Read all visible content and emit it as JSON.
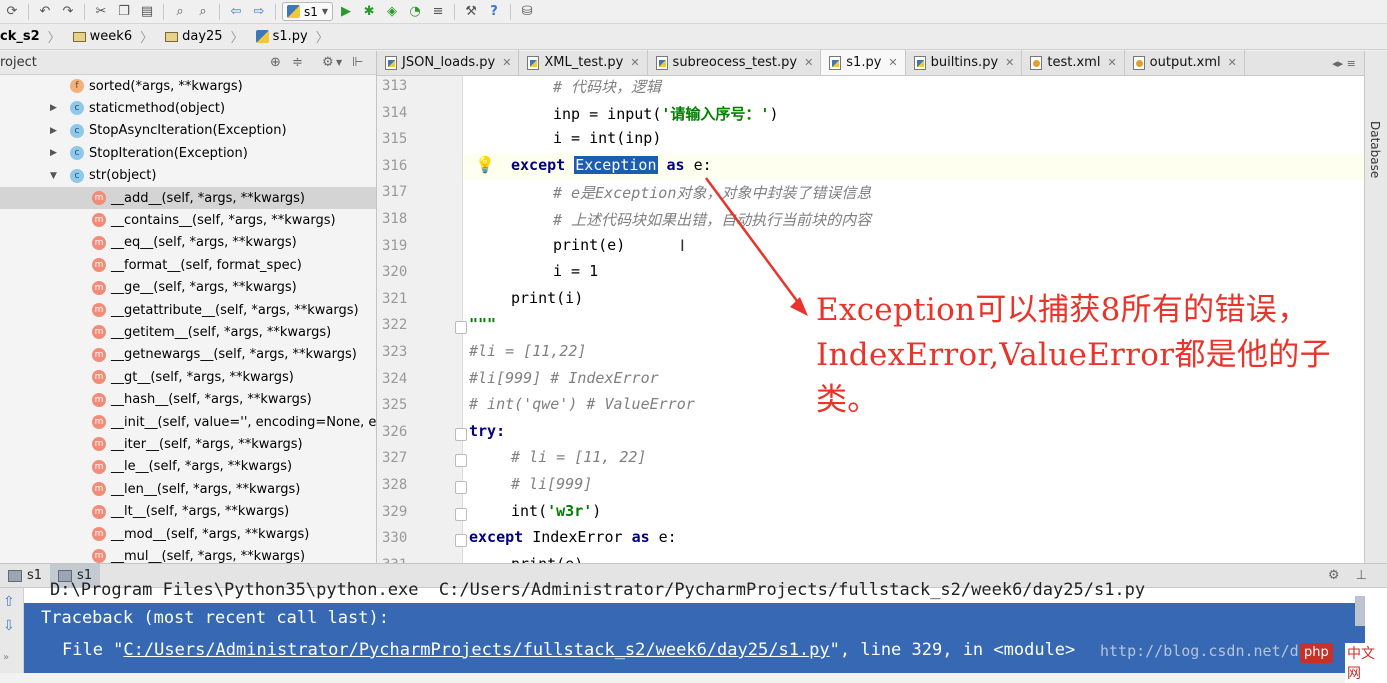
{
  "toolbar": {
    "run_config": "s1",
    "icons": [
      "sync-icon",
      "undo-icon",
      "redo-icon",
      "cut-icon",
      "copy-icon",
      "paste-icon",
      "find-icon",
      "replace-icon",
      "back-icon",
      "forward-icon",
      "run-config-icon",
      "run-icon",
      "debug-icon",
      "coverage-icon",
      "profile-icon",
      "concurrency-icon",
      "settings-icon",
      "help-icon",
      "vcs-icon"
    ]
  },
  "breadcrumb": {
    "items": [
      "ck_s2",
      "week6",
      "day25",
      "s1.py"
    ]
  },
  "project_panel": {
    "title": "roject",
    "tree": [
      {
        "badge": "f",
        "label": "sorted(*args, **kwargs)",
        "arrow": ""
      },
      {
        "badge": "c",
        "label": "staticmethod(object)",
        "arrow": "▶"
      },
      {
        "badge": "c",
        "label": "StopAsyncIteration(Exception)",
        "arrow": "▶"
      },
      {
        "badge": "c",
        "label": "StopIteration(Exception)",
        "arrow": "▶"
      },
      {
        "badge": "c",
        "label": "str(object)",
        "arrow": "▼"
      },
      {
        "badge": "m",
        "label": "__add__(self, *args, **kwargs)",
        "arrow": ""
      },
      {
        "badge": "m",
        "label": "__contains__(self, *args, **kwargs)",
        "arrow": ""
      },
      {
        "badge": "m",
        "label": "__eq__(self, *args, **kwargs)",
        "arrow": ""
      },
      {
        "badge": "m",
        "label": "__format__(self, format_spec)",
        "arrow": ""
      },
      {
        "badge": "m",
        "label": "__ge__(self, *args, **kwargs)",
        "arrow": ""
      },
      {
        "badge": "m",
        "label": "__getattribute__(self, *args, **kwargs)",
        "arrow": ""
      },
      {
        "badge": "m",
        "label": "__getitem__(self, *args, **kwargs)",
        "arrow": ""
      },
      {
        "badge": "m",
        "label": "__getnewargs__(self, *args, **kwargs)",
        "arrow": ""
      },
      {
        "badge": "m",
        "label": "__gt__(self, *args, **kwargs)",
        "arrow": ""
      },
      {
        "badge": "m",
        "label": "__hash__(self, *args, **kwargs)",
        "arrow": ""
      },
      {
        "badge": "m",
        "label": "__init__(self, value='', encoding=None, erro",
        "arrow": ""
      },
      {
        "badge": "m",
        "label": "__iter__(self, *args, **kwargs)",
        "arrow": ""
      },
      {
        "badge": "m",
        "label": "__le__(self, *args, **kwargs)",
        "arrow": ""
      },
      {
        "badge": "m",
        "label": "__len__(self, *args, **kwargs)",
        "arrow": ""
      },
      {
        "badge": "m",
        "label": "__lt__(self, *args, **kwargs)",
        "arrow": ""
      },
      {
        "badge": "m",
        "label": "__mod__(self, *args, **kwargs)",
        "arrow": ""
      },
      {
        "badge": "m",
        "label": "__mul__(self, *args, **kwargs)",
        "arrow": ""
      }
    ]
  },
  "tabs": [
    {
      "label": "JSON_loads.py",
      "icon": "py",
      "active": false
    },
    {
      "label": "XML_test.py",
      "icon": "py",
      "active": false
    },
    {
      "label": "subreocess_test.py",
      "icon": "py",
      "active": false
    },
    {
      "label": "s1.py",
      "icon": "py",
      "active": true
    },
    {
      "label": "builtins.py",
      "icon": "py",
      "active": false
    },
    {
      "label": "test.xml",
      "icon": "xml",
      "active": false
    },
    {
      "label": "output.xml",
      "icon": "xml",
      "active": false
    }
  ],
  "editor": {
    "lines": [
      {
        "n": "313",
        "indent": 2,
        "parts": [
          [
            "cm",
            "# 代码块，逻辑"
          ]
        ]
      },
      {
        "n": "314",
        "indent": 2,
        "parts": [
          [
            "",
            "inp = input("
          ],
          [
            "str",
            "'请输入序号：'"
          ],
          [
            "",
            ")"
          ]
        ]
      },
      {
        "n": "315",
        "indent": 2,
        "parts": [
          [
            "",
            "i = int(inp)"
          ]
        ]
      },
      {
        "n": "316",
        "indent": 1,
        "parts": [
          [
            "kw",
            "except "
          ],
          [
            "hl",
            "Exception"
          ],
          [
            "kw",
            " as "
          ],
          [
            "",
            "e:"
          ]
        ]
      },
      {
        "n": "317",
        "indent": 2,
        "parts": [
          [
            "cm",
            "# e是Exception对象，对象中封装了错误信息"
          ]
        ]
      },
      {
        "n": "318",
        "indent": 2,
        "parts": [
          [
            "cm",
            "# 上述代码块如果出错，自动执行当前块的内容"
          ]
        ]
      },
      {
        "n": "319",
        "indent": 2,
        "parts": [
          [
            "",
            "print(e)"
          ]
        ]
      },
      {
        "n": "320",
        "indent": 2,
        "parts": [
          [
            "",
            "i = 1"
          ]
        ]
      },
      {
        "n": "321",
        "indent": 1,
        "parts": [
          [
            "",
            "print(i)"
          ]
        ]
      },
      {
        "n": "322",
        "indent": 0,
        "parts": [
          [
            "str",
            "\"\"\""
          ]
        ]
      },
      {
        "n": "323",
        "indent": 0,
        "parts": [
          [
            "cn",
            "#li = [11,22]"
          ]
        ]
      },
      {
        "n": "324",
        "indent": 0,
        "parts": [
          [
            "cn",
            "#li[999] # IndexError"
          ]
        ]
      },
      {
        "n": "325",
        "indent": 0,
        "parts": [
          [
            "cn",
            "# int('qwe') # ValueError"
          ]
        ]
      },
      {
        "n": "326",
        "indent": 0,
        "parts": [
          [
            "kw",
            "try:"
          ]
        ]
      },
      {
        "n": "327",
        "indent": 1,
        "parts": [
          [
            "cn",
            "# li = [11, 22]"
          ]
        ]
      },
      {
        "n": "328",
        "indent": 1,
        "parts": [
          [
            "cn",
            "# li[999]"
          ]
        ]
      },
      {
        "n": "329",
        "indent": 1,
        "parts": [
          [
            "",
            "int("
          ],
          [
            "str",
            "'w3r'"
          ],
          [
            "",
            ")"
          ]
        ]
      },
      {
        "n": "330",
        "indent": 0,
        "parts": [
          [
            "kw",
            "except "
          ],
          [
            "",
            "IndexError "
          ],
          [
            "kw",
            "as "
          ],
          [
            "",
            "e:"
          ]
        ]
      },
      {
        "n": "331",
        "indent": 1,
        "parts": [
          [
            "",
            "print(e)"
          ]
        ]
      }
    ]
  },
  "annotation": {
    "line1": "Exception可以捕获8所有的错误，",
    "line2": "IndexError,ValueError都是他的子",
    "line3": "类。",
    "color": "#e8342a"
  },
  "right_strip": {
    "label": "Database"
  },
  "run_panel": {
    "tabs": [
      "s1",
      "s1"
    ],
    "console": {
      "line0": "D:\\Program Files\\Python35\\python.exe  C:/Users/Administrator/PycharmProjects/fullstack_s2/week6/day25/s1.py",
      "line1": "Traceback (most recent call last):",
      "line2_prefix": "File \"",
      "line2_link": "C:/Users/Administrator/PycharmProjects/fullstack_s2/week6/day25/s1.py",
      "line2_suffix": "\", line 329, in <module>"
    }
  },
  "watermark": {
    "url": "http://blog.csdn.net/d",
    "badge": "php",
    "site": "中文网"
  }
}
